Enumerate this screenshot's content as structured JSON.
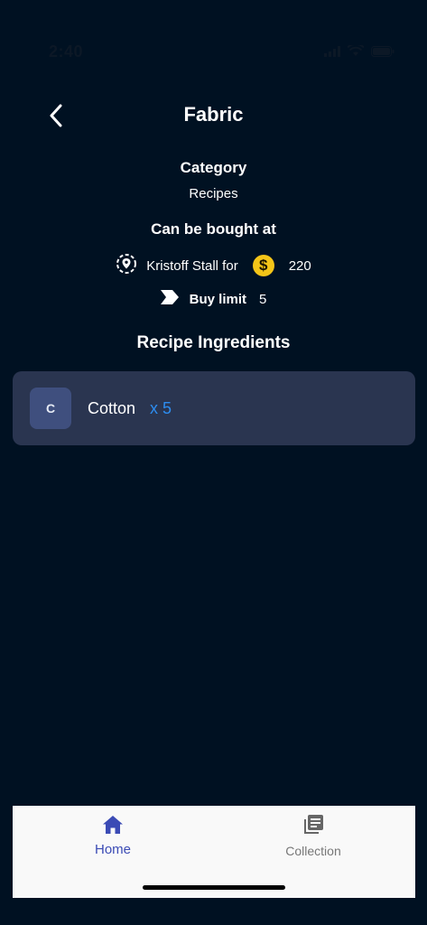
{
  "status_bar": {
    "time": "2:40"
  },
  "header": {
    "title": "Fabric"
  },
  "category": {
    "heading": "Category",
    "value": "Recipes"
  },
  "purchase": {
    "heading": "Can be bought at",
    "seller": "Kristoff Stall for",
    "coin_symbol": "$",
    "price": "220",
    "buy_limit_label": "Buy limit",
    "buy_limit_value": "5"
  },
  "ingredients": {
    "heading": "Recipe Ingredients",
    "items": [
      {
        "initial": "C",
        "name": "Cotton",
        "quantity": "x 5"
      }
    ]
  },
  "tab_bar": {
    "tabs": [
      {
        "label": "Home",
        "icon": "home-icon",
        "active": true
      },
      {
        "label": "Collection",
        "icon": "collection-icon",
        "active": false
      }
    ]
  },
  "colors": {
    "background": "#001122",
    "card": "#2a3550",
    "accent_blue": "#2d8df0",
    "tab_active": "#3b4bb5",
    "coin": "#f5c518"
  }
}
